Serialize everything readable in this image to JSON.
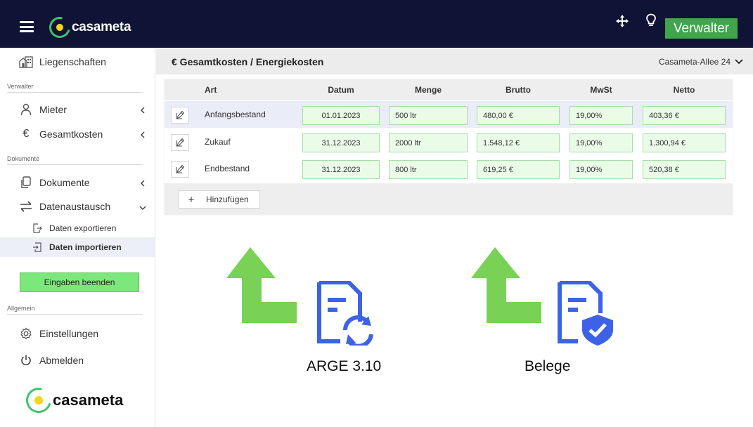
{
  "topbar": {
    "logo_text": "casameta",
    "role_label": "Verwalter",
    "icons": [
      "menu-icon",
      "move-icon",
      "lightbulb-icon"
    ]
  },
  "sidebar": {
    "item_properties": "Liegenschaften",
    "section_manager": "Verwalter",
    "item_tenants": "Mieter",
    "item_total_costs": "Gesamtkosten",
    "section_documents": "Dokumente",
    "item_documents": "Dokumente",
    "item_data_exchange": "Datenaustausch",
    "sub_export": "Daten exportieren",
    "sub_import": "Daten importieren",
    "finish_button": "Eingaben beenden",
    "section_general": "Allgemein",
    "item_settings": "Einstellungen",
    "item_logout": "Abmelden",
    "logo_text": "casameta"
  },
  "header": {
    "title": "€ Gesamtkosten / Energiekosten",
    "property": "Casameta-Allee 24"
  },
  "table": {
    "columns": [
      "Art",
      "Datum",
      "Menge",
      "Brutto",
      "MwSt",
      "Netto"
    ],
    "rows": [
      {
        "art": "Anfangsbestand",
        "datum": "01.01.2023",
        "menge": "500 ltr",
        "brutto": "480,00 €",
        "mwst": "19,00%",
        "netto": "403,36 €"
      },
      {
        "art": "Zukauf",
        "datum": "31.12.2023",
        "menge": "2000 ltr",
        "brutto": "1.548,12 €",
        "mwst": "19,00%",
        "netto": "1.300,94 €"
      },
      {
        "art": "Endbestand",
        "datum": "31.12.2023",
        "menge": "800 ltr",
        "brutto": "619,25 €",
        "mwst": "19,00%",
        "netto": "520,38 €"
      }
    ],
    "add_label": "Hinzufügen"
  },
  "illustration": {
    "caption_left": "ARGE 3.10",
    "caption_right": "Belege",
    "accent_green": "#79d155",
    "accent_blue": "#3d62e8"
  },
  "colors": {
    "topbar": "#0f1336",
    "brand_green": "#3ec46d",
    "role_badge": "#3fa64c",
    "finish_button": "#7ce87c",
    "input_bg": "#eafbe8"
  }
}
